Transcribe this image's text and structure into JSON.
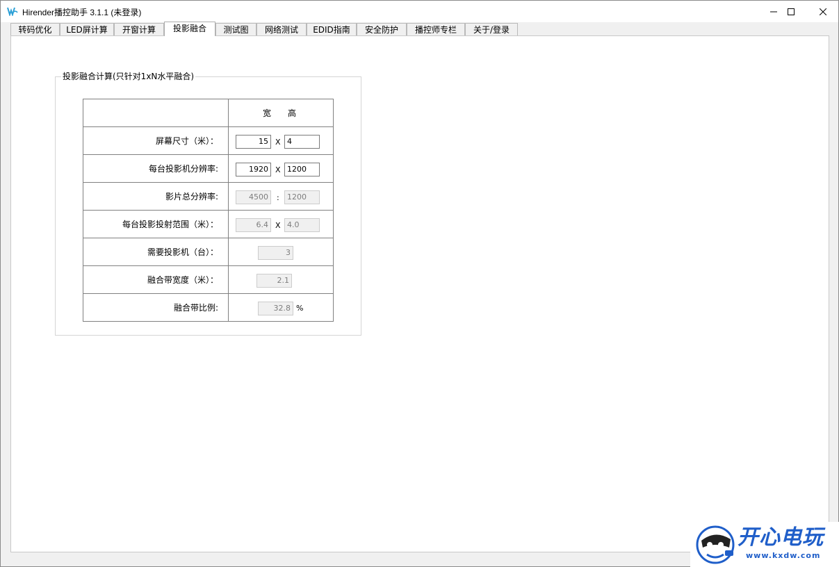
{
  "window": {
    "title": "Hirender播控助手 3.1.1 (未登录)",
    "icon": "hirender-app-icon"
  },
  "tabs": [
    {
      "label": "转码优化",
      "active": false
    },
    {
      "label": "LED屏计算",
      "active": false
    },
    {
      "label": "开窗计算",
      "active": false
    },
    {
      "label": "投影融合",
      "active": true
    },
    {
      "label": "测试图",
      "active": false
    },
    {
      "label": "网络测试",
      "active": false
    },
    {
      "label": "EDID指南",
      "active": false
    },
    {
      "label": "安全防护",
      "active": false
    },
    {
      "label": "播控师专栏",
      "active": false
    },
    {
      "label": "关于/登录",
      "active": false
    }
  ],
  "group": {
    "title": "投影融合计算(只针对1xN水平融合)"
  },
  "table": {
    "header_width": "宽",
    "header_height": "高",
    "rows": {
      "screen_size": {
        "label": "屏幕尺寸（米）：",
        "width": "15",
        "height": "4",
        "sep": "X"
      },
      "projector_resolution": {
        "label": "每台投影机分辨率:",
        "width": "1920",
        "height": "1200",
        "sep": "X"
      },
      "total_resolution": {
        "label": "影片总分辨率:",
        "width": "4500",
        "height": "1200",
        "sep": ":"
      },
      "projection_range": {
        "label": "每台投影投射范围（米）：",
        "width": "6.4",
        "height": "4.0",
        "sep": "X"
      },
      "projector_count": {
        "label": "需要投影机（台）：",
        "value": "3"
      },
      "blend_width": {
        "label": "融合带宽度（米）：",
        "value": "2.1"
      },
      "blend_ratio": {
        "label": "融合带比例:",
        "value": "32.8",
        "unit": "%"
      }
    }
  },
  "watermark": {
    "text": "开心电玩",
    "url": "www.kxdw.com"
  },
  "colors": {
    "watermark_blue": "#1f5ec9",
    "readonly_bg": "#f0f0f0",
    "grid_line": "#808080"
  }
}
